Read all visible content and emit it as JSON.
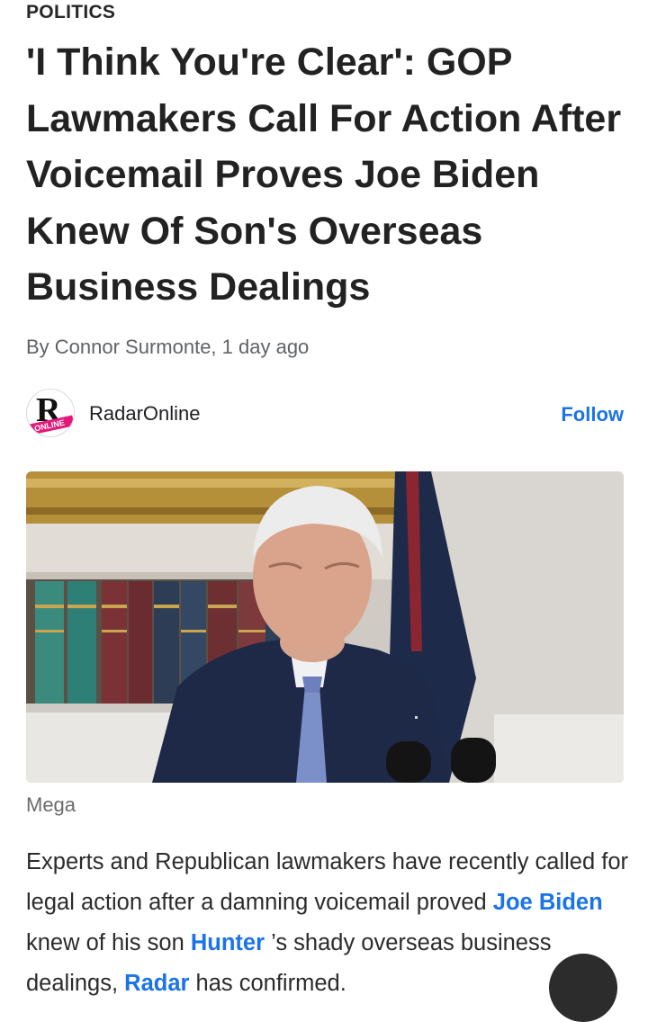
{
  "article": {
    "category": "POLITICS",
    "headline": "'I Think You're Clear': GOP Lawmakers Call For Action After Voicemail Proves Joe Biden Knew Of Son's Overseas Business Dealings",
    "byline": "By Connor Surmonte, 1 day ago",
    "source": {
      "name": "RadarOnline",
      "logo_letter": "R",
      "logo_tag": "ONLINE",
      "follow_label": "Follow"
    },
    "image_caption": "Mega",
    "body": {
      "part1": "Experts and Republican lawmakers have recently called for legal action after a damning voicemail proved ",
      "link1": "Joe Biden",
      "part2": " knew of his son ",
      "link2": "Hunter",
      "part3": " ’s shady overseas business dealings, ",
      "link3": "Radar",
      "part4": " has confirmed."
    }
  },
  "colors": {
    "link": "#1a73e8",
    "logo_accent": "#e5177b"
  },
  "icons": {
    "share_fab": "share-icon"
  }
}
